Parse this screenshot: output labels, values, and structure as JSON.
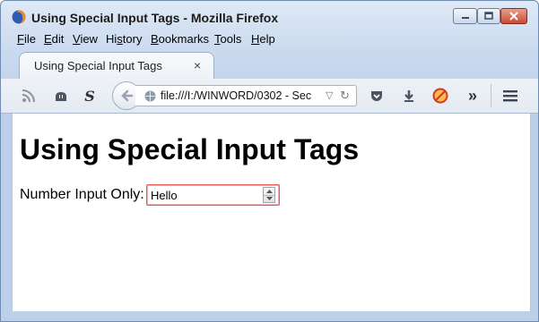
{
  "window": {
    "title": "Using Special Input Tags - Mozilla Firefox"
  },
  "menubar": {
    "items": [
      {
        "key": "F",
        "rest": "ile"
      },
      {
        "key": "E",
        "rest": "dit"
      },
      {
        "key": "V",
        "rest": "iew"
      },
      {
        "key": "",
        "pre": "Hi",
        "ul": "s",
        "post": "tory"
      },
      {
        "key": "B",
        "rest": "ookmarks"
      },
      {
        "key": "T",
        "rest": "ools"
      },
      {
        "key": "H",
        "rest": "elp"
      }
    ]
  },
  "tab": {
    "label": "Using Special Input Tags",
    "close_glyph": "×"
  },
  "navbar": {
    "url": "file:///I:/WINWORD/0302 - Sec",
    "overflow_glyph": "»"
  },
  "page": {
    "heading": "Using Special Input Tags",
    "field_label": "Number Input Only:",
    "input_value": "Hello"
  },
  "colors": {
    "invalid_border": "#e35a5a",
    "window_border": "#6f8bb0"
  }
}
